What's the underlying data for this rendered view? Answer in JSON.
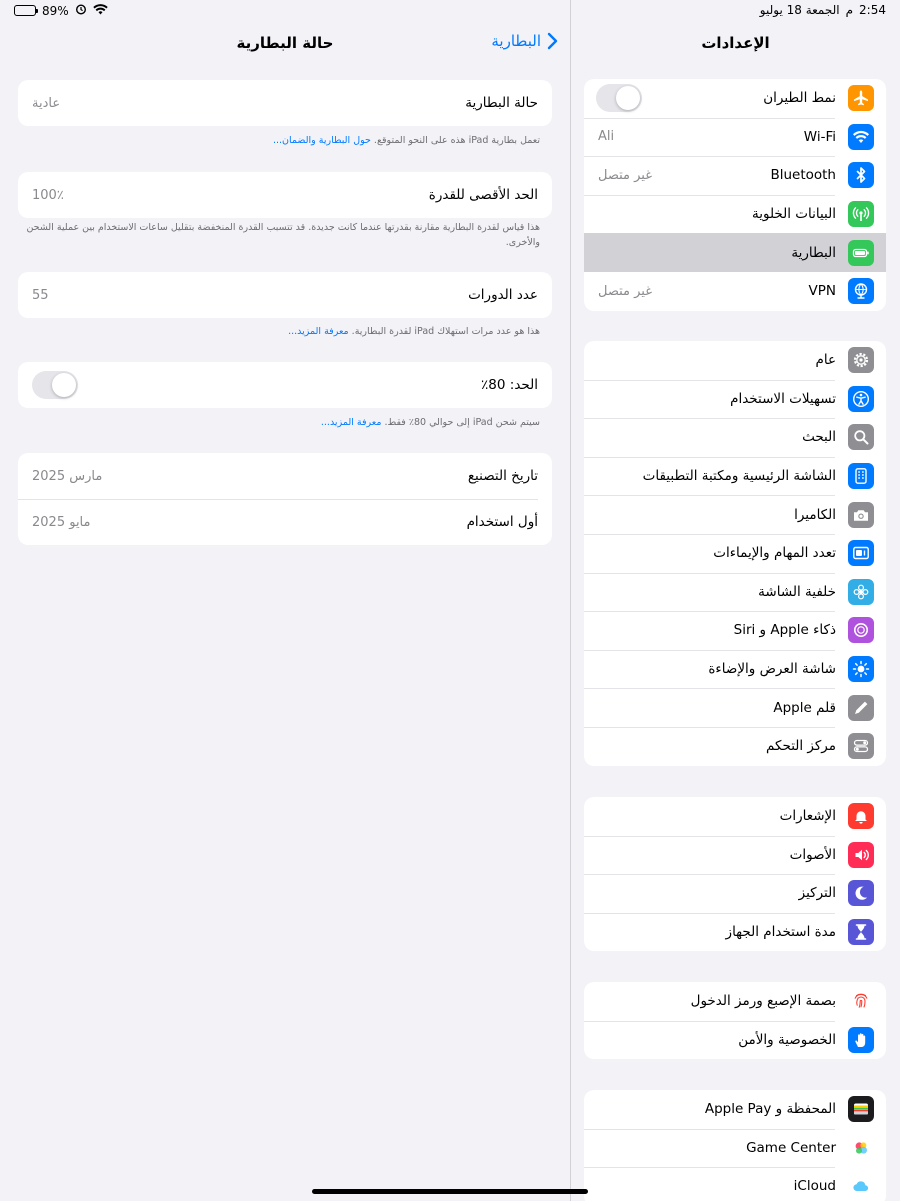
{
  "status_bar": {
    "battery_percent": "89%",
    "time": "2:54",
    "period": "م",
    "date": "الجمعة 18 يوليو"
  },
  "detail": {
    "title": "حالة البطارية",
    "back_label": "البطارية",
    "battery_condition": {
      "label": "حالة البطارية",
      "value": "عادية"
    },
    "condition_note": "تعمل بطارية iPad هذه على النحو المتوقع.",
    "condition_link": "حول البطارية والضمان...",
    "max_capacity": {
      "label": "الحد الأقصى للقدرة",
      "value": "100٪"
    },
    "capacity_note": "هذا قياس لقدرة البطارية مقارنة بقدرتها عندما كانت جديدة. قد تتسبب القدرة المنخفضة بتقليل ساعات الاستخدام بين عملية الشحن والأخرى.",
    "cycle_count": {
      "label": "عدد الدورات",
      "value": "55"
    },
    "cycle_note": "هذا هو عدد مرات استهلاك iPad لقدرة البطارية.",
    "cycle_link": "معرفة المزيد...",
    "limit": {
      "label": "الحد: 80٪",
      "enabled": false
    },
    "limit_note": "سيتم شحن iPad إلى حوالي 80٪ فقط.",
    "limit_link": "معرفة المزيد...",
    "manufacture": {
      "label": "تاريخ التصنيع",
      "value": "مارس 2025"
    },
    "first_use": {
      "label": "أول استخدام",
      "value": "مايو 2025"
    }
  },
  "sidebar": {
    "title": "الإعدادات",
    "group1": [
      {
        "label": "نمط الطيران",
        "icon": "airplane-icon",
        "color": "#ff9500",
        "toggle": false
      },
      {
        "label": "Wi-Fi",
        "icon": "wifi-icon",
        "color": "#007aff",
        "value": "Ali"
      },
      {
        "label": "Bluetooth",
        "icon": "bluetooth-icon",
        "color": "#007aff",
        "value": "غير متصل"
      },
      {
        "label": "البيانات الخلوية",
        "icon": "cellular-icon",
        "color": "#34c759"
      },
      {
        "label": "البطارية",
        "icon": "battery-icon",
        "color": "#34c759",
        "selected": true
      },
      {
        "label": "VPN",
        "icon": "vpn-globe-icon",
        "color": "#007aff",
        "value": "غير متصل"
      }
    ],
    "group2": [
      {
        "label": "عام",
        "icon": "gear-icon",
        "color": "#8e8e93"
      },
      {
        "label": "تسهيلات الاستخدام",
        "icon": "accessibility-icon",
        "color": "#007aff"
      },
      {
        "label": "البحث",
        "icon": "search-icon",
        "color": "#8e8e93"
      },
      {
        "label": "الشاشة الرئيسية ومكتبة التطبيقات",
        "icon": "home-screen-icon",
        "color": "#007aff"
      },
      {
        "label": "الكاميرا",
        "icon": "camera-icon",
        "color": "#8e8e93"
      },
      {
        "label": "تعدد المهام والإيماءات",
        "icon": "multitasking-icon",
        "color": "#007aff"
      },
      {
        "label": "خلفية الشاشة",
        "icon": "wallpaper-flower-icon",
        "color": "#32ade6"
      },
      {
        "label": "ذكاء Apple و Siri",
        "icon": "siri-icon",
        "color": "#af52de"
      },
      {
        "label": "شاشة العرض والإضاءة",
        "icon": "brightness-icon",
        "color": "#007aff"
      },
      {
        "label": "قلم Apple",
        "icon": "pencil-icon",
        "color": "#8e8e93"
      },
      {
        "label": "مركز التحكم",
        "icon": "control-center-icon",
        "color": "#8e8e93"
      }
    ],
    "group3": [
      {
        "label": "الإشعارات",
        "icon": "notifications-icon",
        "color": "#ff3b30"
      },
      {
        "label": "الأصوات",
        "icon": "sounds-icon",
        "color": "#ff2d55"
      },
      {
        "label": "التركيز",
        "icon": "focus-moon-icon",
        "color": "#5856d6"
      },
      {
        "label": "مدة استخدام الجهاز",
        "icon": "hourglass-icon",
        "color": "#5856d6"
      }
    ],
    "group4": [
      {
        "label": "بصمة الإصبع ورمز الدخول",
        "icon": "fingerprint-icon",
        "color": "#ffffff"
      },
      {
        "label": "الخصوصية والأمن",
        "icon": "privacy-hand-icon",
        "color": "#007aff"
      }
    ],
    "group5": [
      {
        "label": "المحفظة و Apple Pay",
        "icon": "wallet-icon",
        "color": "#1c1c1e"
      },
      {
        "label": "Game Center",
        "icon": "game-center-icon",
        "color": "#ffffff"
      },
      {
        "label": "iCloud",
        "icon": "icloud-icon",
        "color": "#ffffff"
      }
    ]
  }
}
